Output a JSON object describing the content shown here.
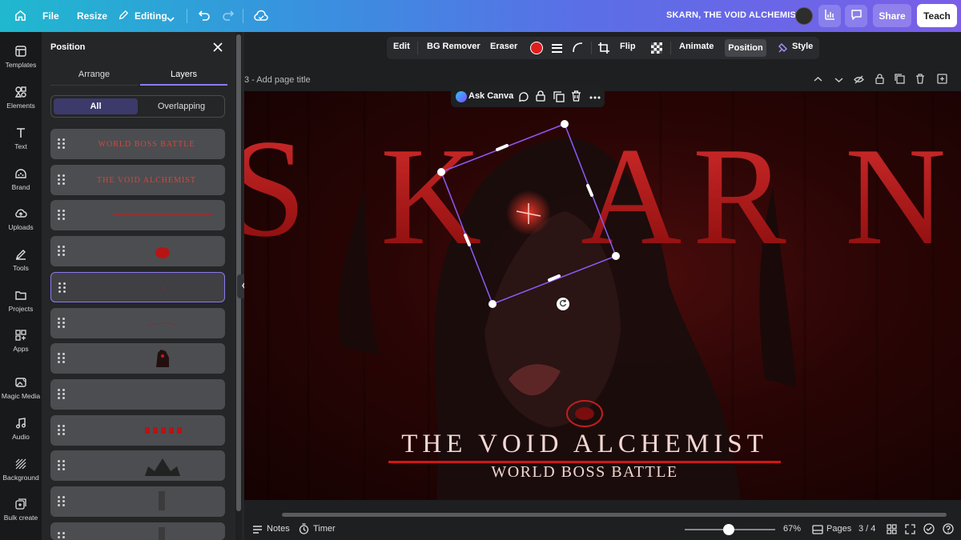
{
  "topbar": {
    "file": "File",
    "resize": "Resize",
    "editing": "Editing",
    "doc_title": "SKARN, THE VOID ALCHEMIST",
    "share": "Share",
    "teach": "Teach"
  },
  "rail": [
    {
      "label": "Templates",
      "icon": "templates-icon"
    },
    {
      "label": "Elements",
      "icon": "elements-icon"
    },
    {
      "label": "Text",
      "icon": "text-icon"
    },
    {
      "label": "Brand",
      "icon": "brand-icon"
    },
    {
      "label": "Uploads",
      "icon": "uploads-icon"
    },
    {
      "label": "Tools",
      "icon": "tools-icon"
    },
    {
      "label": "Projects",
      "icon": "projects-icon"
    },
    {
      "label": "Apps",
      "icon": "apps-icon"
    },
    {
      "label": "Magic Media",
      "icon": "magic-media-icon"
    },
    {
      "label": "Audio",
      "icon": "audio-icon"
    },
    {
      "label": "Background",
      "icon": "background-icon"
    },
    {
      "label": "Bulk create",
      "icon": "bulk-create-icon"
    }
  ],
  "panel": {
    "title": "Position",
    "tab_arrange": "Arrange",
    "tab_layers": "Layers",
    "filter_all": "All",
    "filter_overlapping": "Overlapping",
    "layers": [
      {
        "thumb_text": "WORLD BOSS BATTLE",
        "kind": "text"
      },
      {
        "thumb_text": "THE VOID ALCHEMIST",
        "kind": "text"
      },
      {
        "thumb_text": "",
        "kind": "line"
      },
      {
        "thumb_text": "",
        "kind": "logo"
      },
      {
        "thumb_text": "",
        "kind": "dot",
        "selected": true
      },
      {
        "thumb_text": "",
        "kind": "faint"
      },
      {
        "thumb_text": "",
        "kind": "figure"
      },
      {
        "thumb_text": "",
        "kind": "empty"
      },
      {
        "thumb_text": "",
        "kind": "letters"
      },
      {
        "thumb_text": "",
        "kind": "crown"
      },
      {
        "thumb_text": "",
        "kind": "bar"
      },
      {
        "thumb_text": "",
        "kind": "bar2"
      }
    ]
  },
  "ctx": {
    "edit": "Edit",
    "bg_remover": "BG Remover",
    "eraser": "Eraser",
    "flip": "Flip",
    "animate": "Animate",
    "position": "Position",
    "style": "Style",
    "color": "#e11d1d"
  },
  "page_title": "3 - Add page title",
  "ask": {
    "label": "Ask Canva"
  },
  "design": {
    "big_title": "SKARN",
    "subtitle": "THE VOID ALCHEMIST",
    "tagline": "WORLD BOSS BATTLE"
  },
  "bottom": {
    "notes": "Notes",
    "timer": "Timer",
    "zoom": "67%",
    "pages": "Pages",
    "page_count": "3 / 4"
  }
}
